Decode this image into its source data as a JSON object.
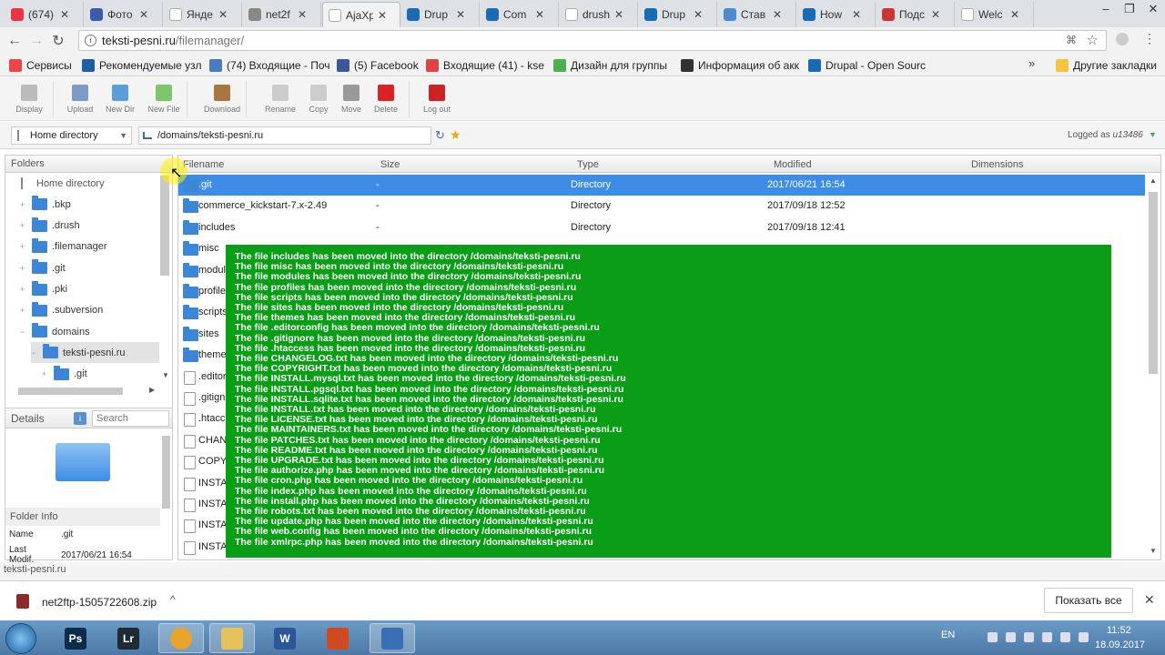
{
  "browser": {
    "tabs": [
      {
        "label": "(674)",
        "color": "#e34"
      },
      {
        "label": "Фото",
        "color": "#3b5ab0"
      },
      {
        "label": "Янде",
        "color": "#fff"
      },
      {
        "label": "net2f",
        "color": "#888"
      },
      {
        "label": "AjaXp",
        "color": "#fff",
        "active": true
      },
      {
        "label": "Drup",
        "color": "#1a6bb5"
      },
      {
        "label": "Com",
        "color": "#1a6bb5"
      },
      {
        "label": "drush",
        "color": "#fff"
      },
      {
        "label": "Drup",
        "color": "#1a6bb5"
      },
      {
        "label": "Став",
        "color": "#4a8ad0"
      },
      {
        "label": "How",
        "color": "#1a6bb5"
      },
      {
        "label": "Подс",
        "color": "#c33"
      },
      {
        "label": "Welc",
        "color": "#fff"
      }
    ],
    "url_host": "teksti-pesni.ru",
    "url_path": "/filemanager/",
    "bookmarks": [
      {
        "label": "Сервисы",
        "color": "#e44"
      },
      {
        "label": "Рекомендуемые узл",
        "color": "#1a5fa8"
      },
      {
        "label": "(74) Входящие - Поч",
        "color": "#4a7bc0"
      },
      {
        "label": "(5) Facebook",
        "color": "#3b5998"
      },
      {
        "label": "Входящие (41) - kse",
        "color": "#d44"
      },
      {
        "label": "Дизайн для группы",
        "color": "#4caf50"
      },
      {
        "label": "Информация об акк",
        "color": "#333"
      },
      {
        "label": "Drupal - Open Sourc",
        "color": "#1a6bb5"
      },
      {
        "label": "Другие закладки",
        "color": "#f4c542"
      }
    ],
    "chevron": "»"
  },
  "toolbar": {
    "buttons": [
      {
        "label": "Display",
        "color": "#bbb"
      },
      {
        "label": "Upload",
        "color": "#7a9cc6"
      },
      {
        "label": "New Dir",
        "color": "#5aa0d8"
      },
      {
        "label": "New File",
        "color": "#7cc76b"
      },
      {
        "label": "Download",
        "color": "#a8773f"
      },
      {
        "label": "Rename",
        "color": "#ccc"
      },
      {
        "label": "Copy",
        "color": "#ccc"
      },
      {
        "label": "Move",
        "color": "#999"
      },
      {
        "label": "Delete",
        "color": "#d22"
      },
      {
        "label": "Log out",
        "color": "#c22"
      }
    ]
  },
  "location": {
    "home_label": "Home directory",
    "path": "/domains/teksti-pesni.ru",
    "logged_prefix": "Logged as ",
    "logged_user": "u13486"
  },
  "folders_panel": {
    "title": "Folders",
    "items": [
      {
        "label": "Home directory",
        "level": 0,
        "expander": ""
      },
      {
        "label": ".bkp",
        "level": 1,
        "expander": "+"
      },
      {
        "label": ".drush",
        "level": 1,
        "expander": "+"
      },
      {
        "label": ".filemanager",
        "level": 1,
        "expander": "+"
      },
      {
        "label": ".git",
        "level": 1,
        "expander": "+"
      },
      {
        "label": ".pki",
        "level": 1,
        "expander": "+"
      },
      {
        "label": ".subversion",
        "level": 1,
        "expander": "+"
      },
      {
        "label": "domains",
        "level": 1,
        "expander": "−"
      },
      {
        "label": "teksti-pesni.ru",
        "level": 2,
        "expander": "−"
      },
      {
        "label": ".git",
        "level": 3,
        "expander": "+"
      }
    ]
  },
  "details_panel": {
    "title": "Details",
    "search_placeholder": "Search",
    "folder_info_title": "Folder Info",
    "name_label": "Name",
    "name_value": ".git",
    "modified_label": "Last Modif.",
    "modified_value": "2017/06/21 16:54"
  },
  "file_list": {
    "columns": [
      "Filename",
      "Size",
      "Type",
      "Modified",
      "Dimensions"
    ],
    "rows": [
      {
        "name": ".git",
        "size": "-",
        "type": "Directory",
        "modified": "2017/06/21 16:54",
        "dir": true,
        "selected": true
      },
      {
        "name": "commerce_kickstart-7.x-2.49",
        "size": "-",
        "type": "Directory",
        "modified": "2017/09/18 12:52",
        "dir": true
      },
      {
        "name": "includes",
        "size": "-",
        "type": "Directory",
        "modified": "2017/09/18 12:41",
        "dir": true
      },
      {
        "name": "misc",
        "size": "",
        "type": "",
        "modified": "",
        "dir": true
      },
      {
        "name": "module",
        "size": "",
        "type": "",
        "modified": "",
        "dir": true
      },
      {
        "name": "profile",
        "size": "",
        "type": "",
        "modified": "",
        "dir": true
      },
      {
        "name": "scripts",
        "size": "",
        "type": "",
        "modified": "",
        "dir": true
      },
      {
        "name": "sites",
        "size": "",
        "type": "",
        "modified": "",
        "dir": true
      },
      {
        "name": "theme",
        "size": "",
        "type": "",
        "modified": "",
        "dir": true
      },
      {
        "name": ".editor",
        "size": "",
        "type": "",
        "modified": "",
        "dir": false
      },
      {
        "name": ".gitign",
        "size": "",
        "type": "",
        "modified": "",
        "dir": false
      },
      {
        "name": ".htacc",
        "size": "",
        "type": "",
        "modified": "",
        "dir": false
      },
      {
        "name": "CHANG",
        "size": "",
        "type": "",
        "modified": "",
        "dir": false
      },
      {
        "name": "COPYR",
        "size": "",
        "type": "",
        "modified": "",
        "dir": false
      },
      {
        "name": "INSTAL",
        "size": "",
        "type": "",
        "modified": "",
        "dir": false
      },
      {
        "name": "INSTAL",
        "size": "",
        "type": "",
        "modified": "",
        "dir": false
      },
      {
        "name": "INSTAL",
        "size": "",
        "type": "",
        "modified": "",
        "dir": false
      },
      {
        "name": "INSTAL",
        "size": "",
        "type": "",
        "modified": "",
        "dir": false
      }
    ]
  },
  "notification": {
    "lines": [
      "The file includes has been moved into the directory /domains/teksti-pesni.ru",
      "The file misc has been moved into the directory /domains/teksti-pesni.ru",
      "The file modules has been moved into the directory /domains/teksti-pesni.ru",
      "The file profiles has been moved into the directory /domains/teksti-pesni.ru",
      "The file scripts has been moved into the directory /domains/teksti-pesni.ru",
      "The file sites has been moved into the directory /domains/teksti-pesni.ru",
      "The file themes has been moved into the directory /domains/teksti-pesni.ru",
      "The file .editorconfig has been moved into the directory /domains/teksti-pesni.ru",
      "The file .gitignore has been moved into the directory /domains/teksti-pesni.ru",
      "The file .htaccess has been moved into the directory /domains/teksti-pesni.ru",
      "The file CHANGELOG.txt has been moved into the directory /domains/teksti-pesni.ru",
      "The file COPYRIGHT.txt has been moved into the directory /domains/teksti-pesni.ru",
      "The file INSTALL.mysql.txt has been moved into the directory /domains/teksti-pesni.ru",
      "The file INSTALL.pgsql.txt has been moved into the directory /domains/teksti-pesni.ru",
      "The file INSTALL.sqlite.txt has been moved into the directory /domains/teksti-pesni.ru",
      "The file INSTALL.txt has been moved into the directory /domains/teksti-pesni.ru",
      "The file LICENSE.txt has been moved into the directory /domains/teksti-pesni.ru",
      "The file MAINTAINERS.txt has been moved into the directory /domains/teksti-pesni.ru",
      "The file PATCHES.txt has been moved into the directory /domains/teksti-pesni.ru",
      "The file README.txt has been moved into the directory /domains/teksti-pesni.ru",
      "The file UPGRADE.txt has been moved into the directory /domains/teksti-pesni.ru",
      "The file authorize.php has been moved into the directory /domains/teksti-pesni.ru",
      "The file cron.php has been moved into the directory /domains/teksti-pesni.ru",
      "The file index.php has been moved into the directory /domains/teksti-pesni.ru",
      "The file install.php has been moved into the directory /domains/teksti-pesni.ru",
      "The file robots.txt has been moved into the directory /domains/teksti-pesni.ru",
      "The file update.php has been moved into the directory /domains/teksti-pesni.ru",
      "The file web.config has been moved into the directory /domains/teksti-pesni.ru",
      "The file xmlrpc.php has been moved into the directory /domains/teksti-pesni.ru"
    ]
  },
  "status_bar": {
    "text": "teksti-pesni.ru"
  },
  "downloads": {
    "file": "net2ftp-1505722608.zip",
    "show_all": "Показать все"
  },
  "taskbar": {
    "apps": [
      {
        "label": "Ps",
        "color": "#0b2b4a"
      },
      {
        "label": "Lr",
        "color": "#1f2b33"
      },
      {
        "label": "",
        "color": "#e8a32b"
      },
      {
        "label": "",
        "color": "#e6c35a"
      },
      {
        "label": "W",
        "color": "#2b579a"
      },
      {
        "label": "",
        "color": "#d04a1f"
      },
      {
        "label": "",
        "color": "#3a6fb5"
      }
    ],
    "lang": "EN",
    "time": "11:52",
    "date": "18.09.2017"
  }
}
